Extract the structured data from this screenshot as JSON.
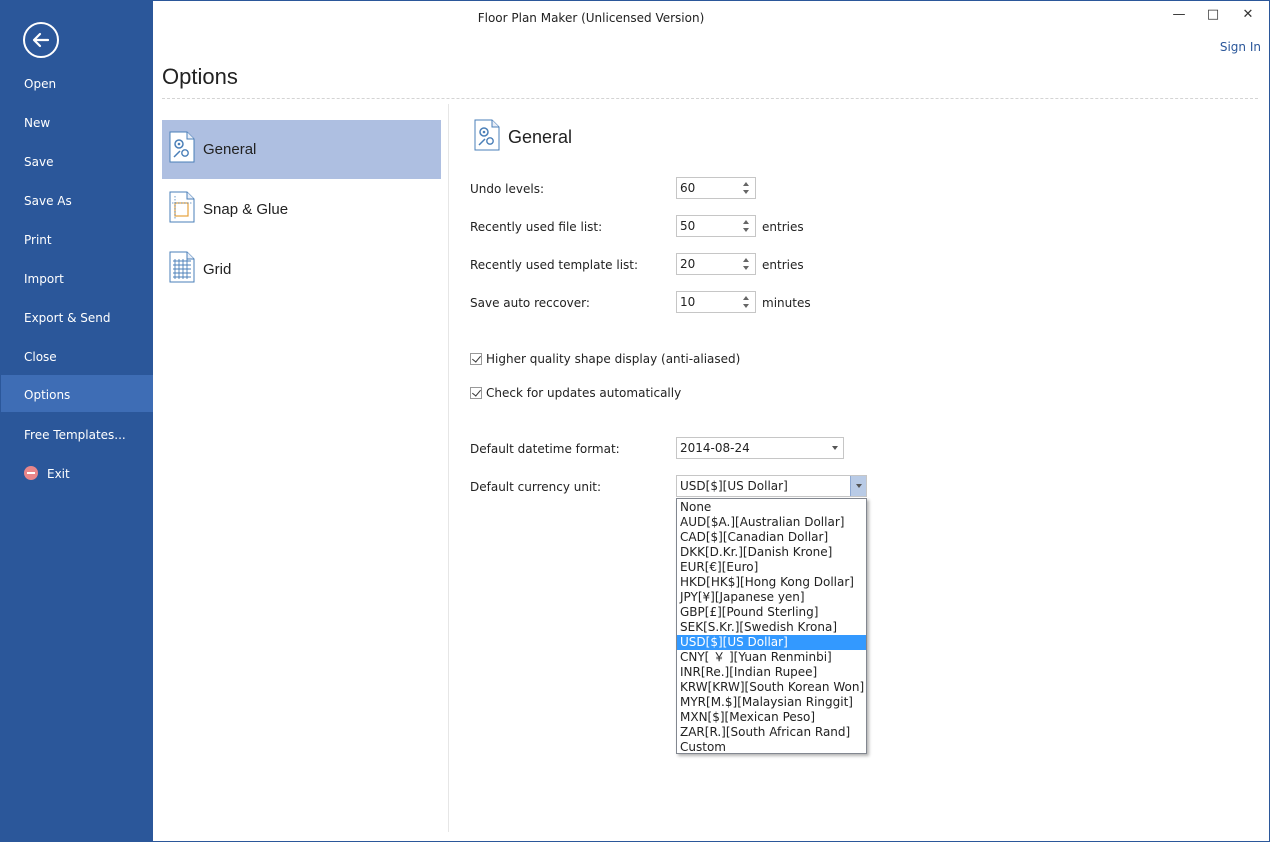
{
  "window": {
    "title": "Floor Plan Maker (Unlicensed Version)",
    "minimize": "—",
    "maximize": "□",
    "close": "✕",
    "sign_in": "Sign In"
  },
  "sidebar": {
    "items": [
      {
        "label": "Open"
      },
      {
        "label": "New"
      },
      {
        "label": "Save"
      },
      {
        "label": "Save As"
      },
      {
        "label": "Print"
      },
      {
        "label": "Import"
      },
      {
        "label": "Export & Send"
      },
      {
        "label": "Close"
      },
      {
        "label": "Options",
        "active": true
      },
      {
        "label": "Free Templates..."
      },
      {
        "label": "Exit"
      }
    ]
  },
  "page": {
    "title": "Options"
  },
  "categories": [
    {
      "label": "General",
      "icon": "general-settings-icon",
      "active": true
    },
    {
      "label": "Snap & Glue",
      "icon": "snap-glue-icon"
    },
    {
      "label": "Grid",
      "icon": "grid-icon"
    }
  ],
  "general": {
    "title": "General",
    "undo_levels": {
      "label": "Undo levels:",
      "value": "60"
    },
    "recent_files": {
      "label": "Recently used file list:",
      "value": "50",
      "unit": "entries"
    },
    "recent_templates": {
      "label": "Recently used template list:",
      "value": "20",
      "unit": "entries"
    },
    "auto_recover": {
      "label": "Save auto reccover:",
      "value": "10",
      "unit": "minutes"
    },
    "high_quality": {
      "label": "Higher quality shape display (anti-aliased)",
      "checked": true
    },
    "check_updates": {
      "label": "Check for updates automatically",
      "checked": true
    },
    "datetime": {
      "label": "Default datetime format:",
      "value": "2014-08-24"
    },
    "currency": {
      "label": "Default currency unit:",
      "value": "USD[$][US Dollar]",
      "options": [
        "None",
        "AUD[$A.][Australian Dollar]",
        "CAD[$][Canadian Dollar]",
        "DKK[D.Kr.][Danish Krone]",
        "EUR[€][Euro]",
        "HKD[HK$][Hong Kong Dollar]",
        "JPY[¥][Japanese yen]",
        "GBP[£][Pound Sterling]",
        "SEK[S.Kr.][Swedish Krona]",
        "USD[$][US Dollar]",
        "CNY[ ￥ ][Yuan Renminbi]",
        "INR[Re.][Indian Rupee]",
        "KRW[KRW][South Korean Won]",
        "MYR[M.$][Malaysian Ringgit]",
        "MXN[$][Mexican Peso]",
        "ZAR[R.][South African Rand]",
        "Custom"
      ],
      "selected_index": 9
    }
  },
  "colors": {
    "sidebar": "#2b579a",
    "sidebar_active": "#3e6db5",
    "category_active": "#aebfe1",
    "list_selection": "#3399ff"
  }
}
